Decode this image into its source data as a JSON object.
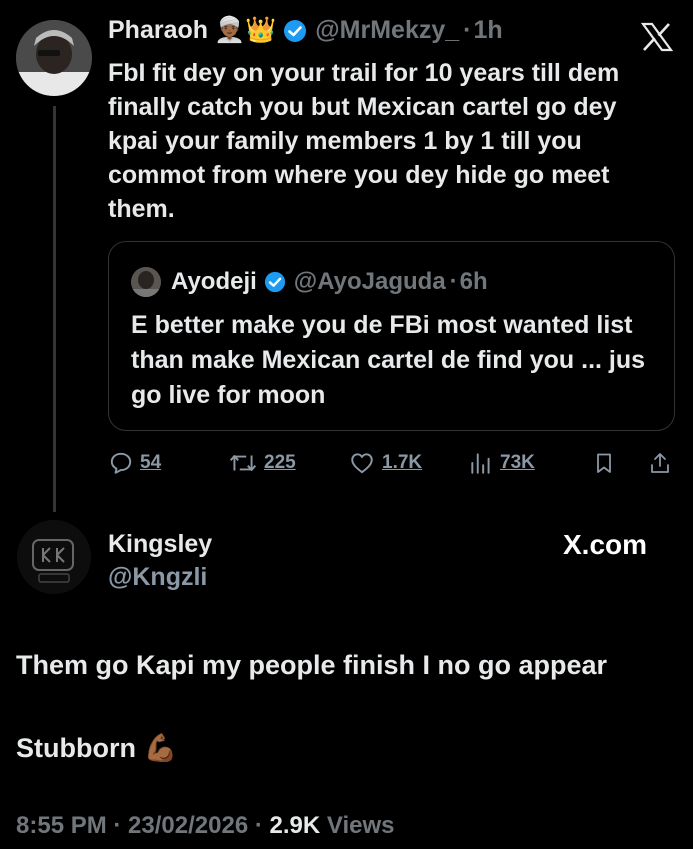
{
  "tweet": {
    "author_name": "Pharaoh",
    "author_emoji": "👳🏾‍♂️👑",
    "handle": "@MrMekzy_",
    "dot": "·",
    "time": "1h",
    "text": "FbI fit dey on your trail for 10 years till dem finally catch you but Mexican cartel go dey kpai your family members 1 by 1 till you commot from where you dey hide go meet them.",
    "quote": {
      "author_name": "Ayodeji",
      "handle": "@AyoJaguda",
      "dot": "·",
      "time": "6h",
      "text": "E better make you de FBi most wanted list than make Mexican cartel de find you ... jus go live for moon"
    },
    "actions": {
      "replies": "54",
      "reposts": "225",
      "likes": "1.7K",
      "views": "73K"
    }
  },
  "share_card": {
    "name": "Kingsley",
    "handle": "@Kngzli",
    "brand": "X.com",
    "line1": "Them go Kapi my people finish I no go appear",
    "line2": "Stubborn",
    "line2_emoji": "💪🏾",
    "footer": {
      "time": "8:55 PM",
      "sep1": "·",
      "date": "23/02/2026",
      "sep2": "·",
      "views_count": "2.9K",
      "views_label": "Views"
    }
  },
  "colors": {
    "background": "#000000",
    "text": "#e7e9ea",
    "muted": "#71767b",
    "verified": "#1d9bf0"
  }
}
